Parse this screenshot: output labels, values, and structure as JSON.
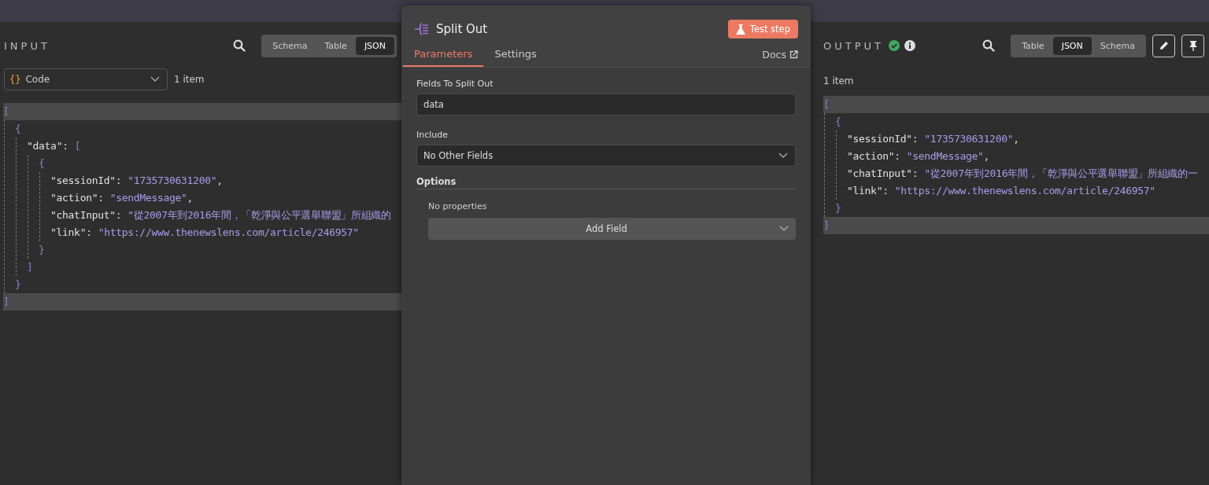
{
  "input": {
    "title": "INPUT",
    "view_tabs": [
      {
        "label": "Schema",
        "selected": false
      },
      {
        "label": "Table",
        "selected": false
      },
      {
        "label": "JSON",
        "selected": true
      }
    ],
    "node_select": {
      "icon": "{}",
      "value": "Code"
    },
    "item_count": "1 item",
    "json": {
      "open": "[",
      "close": "]",
      "children": [
        {
          "open": "{",
          "close": "}",
          "children": [
            {
              "key": "\"data\":",
              "open": "[",
              "close": "]",
              "children": [
                {
                  "open": "{",
                  "close": "}",
                  "children": [
                    {
                      "key": "\"sessionId\":",
                      "value": "\"1735730631200\"",
                      "punct": ","
                    },
                    {
                      "key": "\"action\":",
                      "value": "\"sendMessage\"",
                      "punct": ","
                    },
                    {
                      "key": "\"chatInput\":",
                      "value": "\"從2007年到2016年間，「乾淨與公平選舉聯盟」所組織的"
                    },
                    {
                      "key": "\"link\":",
                      "value": "\"https://www.thenewslens.com/article/246957\""
                    }
                  ]
                }
              ]
            }
          ]
        }
      ]
    }
  },
  "node": {
    "title": "Split Out",
    "test_button": "Test step",
    "tabs": [
      {
        "label": "Parameters",
        "selected": true
      },
      {
        "label": "Settings",
        "selected": false
      }
    ],
    "docs_link": "Docs",
    "fields": [
      {
        "kind": "text",
        "label": "Fields To Split Out",
        "value": "data"
      },
      {
        "kind": "select",
        "label": "Include",
        "value": "No Other Fields"
      }
    ],
    "options": {
      "title": "Options",
      "empty_text": "No properties",
      "add_button": "Add Field"
    }
  },
  "output": {
    "title": "OUTPUT",
    "view_tabs": [
      {
        "label": "Table",
        "selected": false
      },
      {
        "label": "JSON",
        "selected": true
      },
      {
        "label": "Schema",
        "selected": false
      }
    ],
    "item_count": "1 item",
    "json": {
      "open": "[",
      "close": "]",
      "children": [
        {
          "open": "{",
          "close": "}",
          "children": [
            {
              "key": "\"sessionId\":",
              "value": "\"1735730631200\"",
              "punct": ","
            },
            {
              "key": "\"action\":",
              "value": "\"sendMessage\"",
              "punct": ","
            },
            {
              "key": "\"chatInput\":",
              "value": "\"從2007年到2016年間，「乾淨與公平選舉聯盟」所組織的一"
            },
            {
              "key": "\"link\":",
              "value": "\"https://www.thenewslens.com/article/246957\""
            }
          ]
        }
      ]
    }
  }
}
